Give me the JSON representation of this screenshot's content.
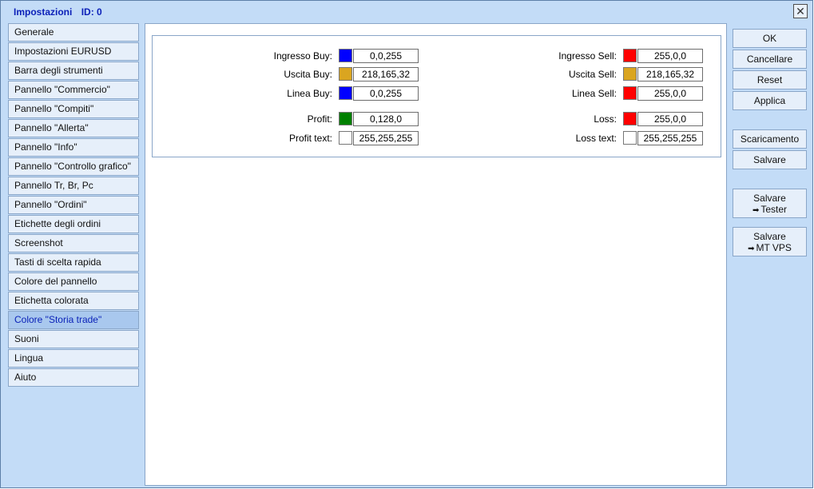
{
  "window": {
    "title": "Impostazioni",
    "id_label": "ID: 0",
    "close_glyph": "✕"
  },
  "sidebar": {
    "items": [
      {
        "label": "Generale"
      },
      {
        "label": "Impostazioni EURUSD"
      },
      {
        "label": "Barra degli strumenti"
      },
      {
        "label": "Pannello \"Commercio\""
      },
      {
        "label": "Pannello \"Compiti\""
      },
      {
        "label": "Pannello \"Allerta\""
      },
      {
        "label": "Pannello \"Info\""
      },
      {
        "label": "Pannello \"Controllo grafico\""
      },
      {
        "label": "Pannello Tr, Br, Pc"
      },
      {
        "label": "Pannello \"Ordini\""
      },
      {
        "label": "Etichette degli ordini"
      },
      {
        "label": "Screenshot"
      },
      {
        "label": "Tasti di scelta rapida"
      },
      {
        "label": "Colore del pannello"
      },
      {
        "label": "Etichetta colorata"
      },
      {
        "label": "Colore \"Storia trade\"",
        "active": true
      },
      {
        "label": "Suoni"
      },
      {
        "label": "Lingua"
      },
      {
        "label": "Aiuto"
      }
    ]
  },
  "colors": {
    "left": [
      {
        "label": "Ingresso Buy:",
        "value": "0,0,255",
        "swatch": "#0000ff"
      },
      {
        "label": "Uscita Buy:",
        "value": "218,165,32",
        "swatch": "#daa520"
      },
      {
        "label": "Linea Buy:",
        "value": "0,0,255",
        "swatch": "#0000ff"
      },
      {
        "label": "Profit:",
        "value": "0,128,0",
        "swatch": "#008000"
      },
      {
        "label": "Profit text:",
        "value": "255,255,255",
        "swatch": "#ffffff"
      }
    ],
    "right": [
      {
        "label": "Ingresso Sell:",
        "value": "255,0,0",
        "swatch": "#ff0000"
      },
      {
        "label": "Uscita Sell:",
        "value": "218,165,32",
        "swatch": "#daa520"
      },
      {
        "label": "Linea Sell:",
        "value": "255,0,0",
        "swatch": "#ff0000"
      },
      {
        "label": "Loss:",
        "value": "255,0,0",
        "swatch": "#ff0000"
      },
      {
        "label": "Loss text:",
        "value": "255,255,255",
        "swatch": "#ffffff"
      }
    ]
  },
  "buttons": {
    "ok": "OK",
    "cancel": "Cancellare",
    "reset": "Reset",
    "apply": "Applica",
    "download": "Scaricamento",
    "save": "Salvare",
    "save_tester_top": "Salvare",
    "save_tester_bottom": "Tester",
    "save_vps_top": "Salvare",
    "save_vps_bottom": "MT VPS",
    "arrow_glyph": "➡"
  },
  "theme": {
    "title_color": "#0b1fb8",
    "window_bg": "#c3dcf7",
    "active_item_bg": "#a9c8ee"
  }
}
